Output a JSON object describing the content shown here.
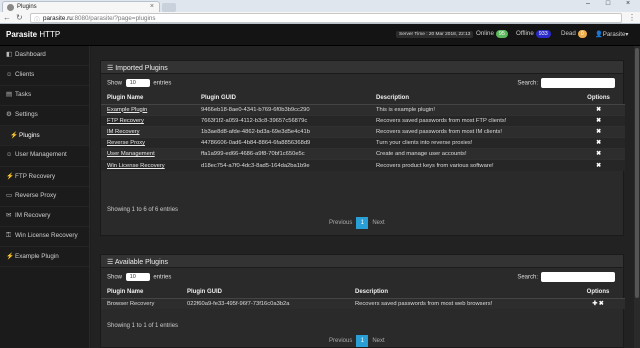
{
  "browser": {
    "tab_title": "Plugins",
    "url_host": "parasite.ru",
    "url_rest": ":8080/parasite/?page=plugins"
  },
  "topbar": {
    "brand_bold": "Parasite",
    "brand_rest": " HTTP",
    "server_time": "Server Time : 20 Mar 2018, 22:13",
    "online_label": "Online",
    "online_count": "95",
    "offline_label": "Offline",
    "offline_count": "933",
    "dead_label": "Dead",
    "dead_count": "0",
    "user": "Parasite",
    "colors": {
      "online": "#5cb85c",
      "offline": "#2a2ac8",
      "dead": "#f0ad4e"
    }
  },
  "sidebar": {
    "items": [
      {
        "icon": "dashboard-icon",
        "glyph": "◧",
        "label": "Dashboard"
      },
      {
        "icon": "clients-icon",
        "glyph": "👥",
        "label": "Clients"
      },
      {
        "icon": "tasks-icon",
        "glyph": "▤",
        "label": "Tasks"
      },
      {
        "icon": "settings-icon",
        "glyph": "⚙",
        "label": "Settings"
      },
      {
        "icon": "plugins-icon",
        "glyph": "🔌",
        "label": "Plugins"
      },
      {
        "icon": "user-management-icon",
        "glyph": "👥",
        "label": "User Management"
      },
      {
        "icon": "ftp-recovery-icon",
        "glyph": "🔌",
        "label": "FTP Recovery"
      },
      {
        "icon": "reverse-proxy-icon",
        "glyph": "🔌",
        "label": "Reverse Proxy"
      },
      {
        "icon": "im-recovery-icon",
        "glyph": "🔌",
        "label": "IM Recovery"
      },
      {
        "icon": "win-license-recovery-icon",
        "glyph": "🔌",
        "label": "Win License Recovery"
      },
      {
        "icon": "example-plugin-icon",
        "glyph": "🔌",
        "label": "Example Plugin"
      }
    ]
  },
  "imported": {
    "title": "Imported Plugins",
    "show": "Show",
    "entries_value": "10",
    "entries": "entries",
    "search": "Search:",
    "headers": [
      "Plugin Name",
      "Plugin GUID",
      "Description",
      "Options"
    ],
    "rows": [
      {
        "name": "Example Plugin",
        "guid": "9466eb18-8ae0-4341-b769-6f0b3b9cc290",
        "desc": "This is example plugin!",
        "opt": "✖"
      },
      {
        "name": "FTP Recovery",
        "guid": "7663f1f2-a059-4112-b3c8-39657c56879c",
        "desc": "Recovers saved passwords from most FTP clients!",
        "opt": "✖"
      },
      {
        "name": "IM Recovery",
        "guid": "1b3ae8d8-afde-4862-bd3a-69e3d5e4c41b",
        "desc": "Recovers saved passwords from most IM clients!",
        "opt": "✖"
      },
      {
        "name": "Reverse Proxy",
        "guid": "44786606-0ad6-4b84-8864-6fa8856368d9",
        "desc": "Turn your clients into reverse proxies!",
        "opt": "✖"
      },
      {
        "name": "User Management",
        "guid": "ffa1a999-ed66-4686-a9f8-70bf1c650e5c",
        "desc": "Create and manage user accounts!",
        "opt": "✖"
      },
      {
        "name": "Win License Recovery",
        "guid": "d18ec754-a7f0-4dc3-8ad5-164da2ba1b9e",
        "desc": "Recovers product keys from various software!",
        "opt": "✖"
      }
    ],
    "showing": "Showing 1 to 6 of 6 entries",
    "previous": "Previous",
    "page": "1",
    "next": "Next"
  },
  "available": {
    "title": "Available Plugins",
    "show": "Show",
    "entries_value": "10",
    "entries": "entries",
    "search": "Search:",
    "headers": [
      "Plugin Name",
      "Plugin GUID",
      "Description",
      "Options"
    ],
    "rows": [
      {
        "name": "Browser Recovery",
        "guid": "022f60a9-fe33-495f-96f7-73f16c0a3b2a",
        "desc": "Recovers saved passwords from most web browsers!",
        "opt": "✚ ✖"
      }
    ],
    "showing": "Showing 1 to 1 of 1 entries",
    "previous": "Previous",
    "page": "1",
    "next": "Next"
  }
}
